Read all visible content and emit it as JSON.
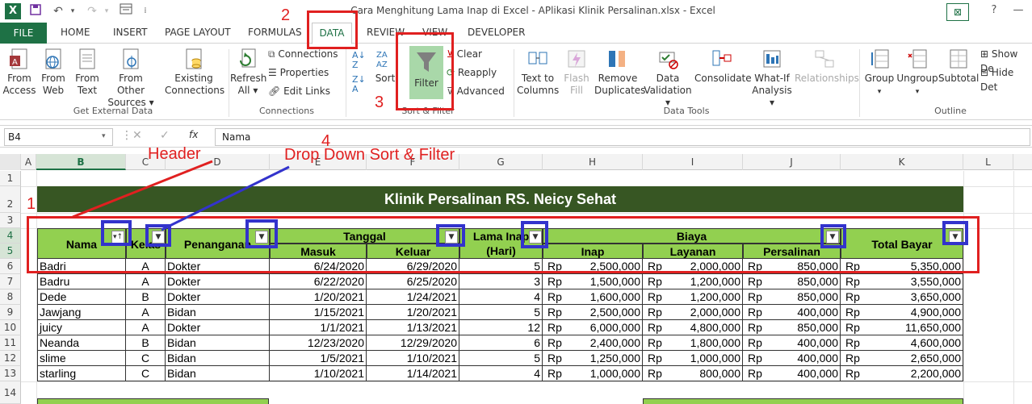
{
  "window": {
    "title": "Cara Menghitung Lama Inap di Excel - APlikasi Klinik Persalinan.xlsx - Excel",
    "app_logo": "X",
    "help": "?"
  },
  "tabs": [
    "FILE",
    "HOME",
    "INSERT",
    "PAGE LAYOUT",
    "FORMULAS",
    "DATA",
    "REVIEW",
    "VIEW",
    "DEVELOPER"
  ],
  "ribbon": {
    "get_external": {
      "from_access": [
        "From",
        "Access"
      ],
      "from_web": [
        "From",
        "Web"
      ],
      "from_text": [
        "From",
        "Text"
      ],
      "from_other": [
        "From Other",
        "Sources ▾"
      ],
      "existing": [
        "Existing",
        "Connections"
      ],
      "group": "Get External Data"
    },
    "connections": {
      "refresh": [
        "Refresh",
        "All ▾"
      ],
      "connections": "Connections",
      "properties": "Properties",
      "edit_links": "Edit Links",
      "group": "Connections"
    },
    "sort_filter": {
      "sort": "Sort",
      "filter": "Filter",
      "clear": "Clear",
      "reapply": "Reapply",
      "advanced": "Advanced",
      "group": "Sort & Filter"
    },
    "data_tools": {
      "text_to_columns": [
        "Text to",
        "Columns"
      ],
      "flash_fill": [
        "Flash",
        "Fill"
      ],
      "remove_duplicates": [
        "Remove",
        "Duplicates"
      ],
      "data_validation": [
        "Data",
        "Validation ▾"
      ],
      "consolidate": "Consolidate",
      "what_if": [
        "What-If",
        "Analysis ▾"
      ],
      "relationships": "Relationships",
      "group": "Data Tools"
    },
    "outline": {
      "group_btn": "Group",
      "ungroup": "Ungroup",
      "subtotal": "Subtotal",
      "show_detail": "Show De",
      "hide_detail": "Hide Det",
      "group": "Outline"
    }
  },
  "formula_bar": {
    "name_box": "B4",
    "fx": "fx",
    "content": "Nama"
  },
  "columns": [
    "A",
    "B",
    "C",
    "D",
    "E",
    "F",
    "G",
    "H",
    "I",
    "J",
    "K",
    "L"
  ],
  "rows": [
    "1",
    "2",
    "3",
    "4",
    "5",
    "6",
    "7",
    "8",
    "9",
    "10",
    "11",
    "12",
    "13",
    "14"
  ],
  "sheet": {
    "title": "Klinik Persalinan RS. Neicy Sehat",
    "headers": {
      "nama": "Nama",
      "kelas": "Kelas",
      "penanganan": "Penanganan",
      "tanggal": "Tanggal",
      "masuk": "Masuk",
      "keluar": "Keluar",
      "lama_inap": "Lama Inap",
      "hari": "(Hari)",
      "biaya": "Biaya",
      "inap": "Inap",
      "layanan": "Layanan",
      "persalinan": "Persalinan",
      "total": "Total Bayar"
    },
    "currency": "Rp",
    "data": [
      [
        "Badri",
        "A",
        "Dokter",
        "6/24/2020",
        "6/29/2020",
        "5",
        "2,500,000",
        "2,000,000",
        "850,000",
        "5,350,000"
      ],
      [
        "Badru",
        "A",
        "Dokter",
        "6/22/2020",
        "6/25/2020",
        "3",
        "1,500,000",
        "1,200,000",
        "850,000",
        "3,550,000"
      ],
      [
        "Dede",
        "B",
        "Dokter",
        "1/20/2021",
        "1/24/2021",
        "4",
        "1,600,000",
        "1,200,000",
        "850,000",
        "3,650,000"
      ],
      [
        "Jawjang",
        "A",
        "Bidan",
        "1/15/2021",
        "1/20/2021",
        "5",
        "2,500,000",
        "2,000,000",
        "400,000",
        "4,900,000"
      ],
      [
        "juicy",
        "A",
        "Dokter",
        "1/1/2021",
        "1/13/2021",
        "12",
        "6,000,000",
        "4,800,000",
        "850,000",
        "11,650,000"
      ],
      [
        "Neanda",
        "B",
        "Bidan",
        "12/23/2020",
        "12/29/2020",
        "6",
        "2,400,000",
        "1,800,000",
        "400,000",
        "4,600,000"
      ],
      [
        "slime",
        "C",
        "Bidan",
        "1/5/2021",
        "1/10/2021",
        "5",
        "1,250,000",
        "1,000,000",
        "400,000",
        "2,650,000"
      ],
      [
        "starling",
        "C",
        "Bidan",
        "1/10/2021",
        "1/14/2021",
        "4",
        "1,000,000",
        "800,000",
        "400,000",
        "2,200,000"
      ]
    ]
  },
  "annotations": {
    "n1": "1",
    "n2": "2",
    "n3": "3",
    "n4": "4",
    "header": "Header",
    "dropdown": "Drop Down Sort & Filter"
  },
  "colors": {
    "excel_green": "#1e7145",
    "header_fill": "#92d050",
    "title_fill": "#375623",
    "annotation_red": "#e02020",
    "annotation_blue": "#3333cc"
  }
}
